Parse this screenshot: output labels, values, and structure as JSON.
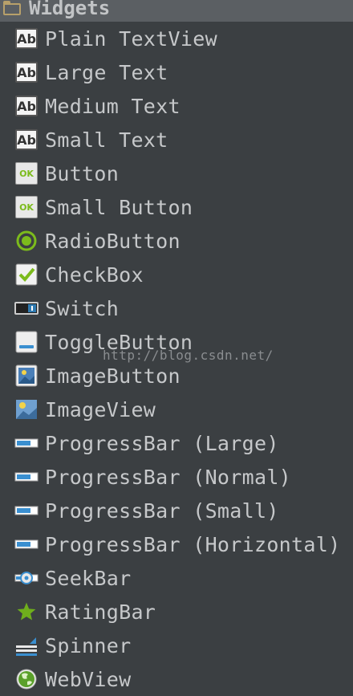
{
  "header": {
    "title": "Widgets"
  },
  "items": [
    {
      "label": "Plain TextView",
      "icon": "ab-text-icon"
    },
    {
      "label": "Large Text",
      "icon": "ab-text-icon"
    },
    {
      "label": "Medium Text",
      "icon": "ab-text-icon"
    },
    {
      "label": "Small Text",
      "icon": "ab-text-icon"
    },
    {
      "label": "Button",
      "icon": "ok-button-icon"
    },
    {
      "label": "Small Button",
      "icon": "ok-button-icon"
    },
    {
      "label": "RadioButton",
      "icon": "radio-button-icon"
    },
    {
      "label": "CheckBox",
      "icon": "checkbox-icon"
    },
    {
      "label": "Switch",
      "icon": "switch-icon"
    },
    {
      "label": "ToggleButton",
      "icon": "toggle-button-icon"
    },
    {
      "label": "ImageButton",
      "icon": "image-button-icon"
    },
    {
      "label": "ImageView",
      "icon": "image-view-icon"
    },
    {
      "label": "ProgressBar (Large)",
      "icon": "progress-bar-icon"
    },
    {
      "label": "ProgressBar (Normal)",
      "icon": "progress-bar-icon"
    },
    {
      "label": "ProgressBar (Small)",
      "icon": "progress-bar-icon"
    },
    {
      "label": "ProgressBar (Horizontal)",
      "icon": "progress-bar-icon"
    },
    {
      "label": "SeekBar",
      "icon": "seek-bar-icon"
    },
    {
      "label": "RatingBar",
      "icon": "star-icon"
    },
    {
      "label": "Spinner",
      "icon": "spinner-icon"
    },
    {
      "label": "WebView",
      "icon": "globe-icon"
    }
  ],
  "icon_text": {
    "ab": "Ab",
    "ok": "OK"
  },
  "watermark": "http://blog.csdn.net/",
  "colors": {
    "background": "#3b3f42",
    "header": "#5b5f63",
    "accent_green": "#7cbb1c",
    "folder": "#b8a06a"
  }
}
